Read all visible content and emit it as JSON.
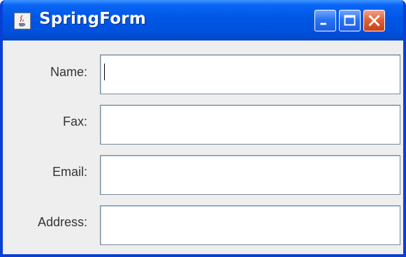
{
  "window": {
    "title": "SpringForm",
    "controls": {
      "minimize_icon": "minimize-icon",
      "maximize_icon": "maximize-icon",
      "close_icon": "close-icon"
    },
    "app_icon": "java-cup-icon"
  },
  "form": {
    "fields": [
      {
        "label": "Name:",
        "value": ""
      },
      {
        "label": "Fax:",
        "value": ""
      },
      {
        "label": "Email:",
        "value": ""
      },
      {
        "label": "Address:",
        "value": ""
      }
    ],
    "focused_field": "Name:"
  },
  "colors": {
    "titlebar": "#0052df",
    "close_button": "#e0633a",
    "panel_background": "#eeeeee",
    "field_border": "#7a8a99"
  }
}
